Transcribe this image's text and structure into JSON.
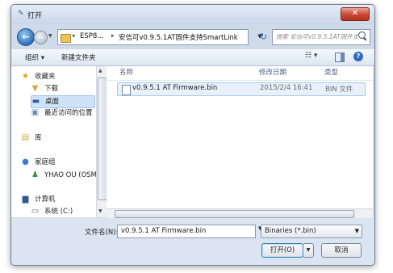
{
  "window": {
    "title": "打开",
    "close_symbol": "✕"
  },
  "address": {
    "parts": [
      "ESP8...",
      "安信可v0.9.5.1AT固件支持SmartLink"
    ],
    "separator": "▸",
    "search_placeholder": "搜索 安信可v0.9.5.1AT固件支..."
  },
  "toolbar": {
    "organize_label": "组织 ▾",
    "new_folder_label": "新建文件夹",
    "view_label": "☷ ▾"
  },
  "nav": {
    "items": [
      {
        "label": "收藏夹",
        "icon": "star-icon"
      },
      {
        "label": "下载",
        "icon": "download-folder-icon"
      },
      {
        "label": "桌面",
        "icon": "desktop-icon",
        "selected": true
      },
      {
        "label": "最近访问的位置",
        "icon": "recent-places-icon"
      },
      {
        "label": "库",
        "icon": "library-icon"
      },
      {
        "label": "家庭组",
        "icon": "homegroup-icon"
      },
      {
        "label": "YHAO OU (OSM",
        "icon": "user-icon"
      },
      {
        "label": "计算机",
        "icon": "computer-icon"
      },
      {
        "label": "系统 (C:)",
        "icon": "drive-icon"
      }
    ]
  },
  "columns": {
    "name": "名称",
    "date": "修改日期",
    "type": "类型"
  },
  "files": [
    {
      "name": "v0.9.5.1 AT Firmware.bin",
      "date": "2015/2/4 16:41",
      "type": "BIN 文件"
    }
  ],
  "footer": {
    "filename_label": "文件名(N):",
    "filename_value": "v0.9.5.1 AT Firmware.bin",
    "filetype_value": "Binaries (*.bin)",
    "open_label": "打开(O)",
    "cancel_label": "取消"
  }
}
